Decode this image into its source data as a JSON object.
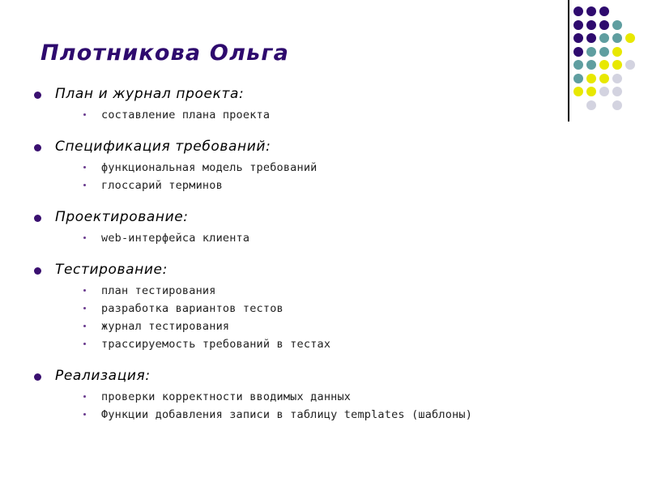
{
  "slide": {
    "title": "Плотникова Ольга",
    "background_color": "#ffffff",
    "title_color": "#2e0a6e",
    "bullet1_color": "#3a1070",
    "bullet2_color": "#6a3b8e",
    "text_color": "#000000"
  },
  "decor": {
    "name": "dot-grid-motif",
    "rule_color": "#000000",
    "palette": {
      "purple": "#2e0a6e",
      "teal": "#5f9ea0",
      "yellow": "#e8e800",
      "gray": "#d3d3e0"
    },
    "columns": 5,
    "rows": 8,
    "grid": [
      [
        "purple",
        "purple",
        "purple",
        "",
        ""
      ],
      [
        "purple",
        "purple",
        "purple",
        "teal",
        ""
      ],
      [
        "purple",
        "purple",
        "teal",
        "teal",
        "yellow"
      ],
      [
        "purple",
        "teal",
        "teal",
        "yellow",
        ""
      ],
      [
        "teal",
        "teal",
        "yellow",
        "yellow",
        "gray"
      ],
      [
        "teal",
        "yellow",
        "yellow",
        "gray",
        ""
      ],
      [
        "yellow",
        "yellow",
        "gray",
        "gray",
        ""
      ],
      [
        "",
        "gray",
        "",
        "gray",
        ""
      ]
    ]
  },
  "outline": [
    {
      "heading": "План и журнал проекта:",
      "items": [
        "составление плана проекта"
      ]
    },
    {
      "heading": "Спецификация требований:",
      "items": [
        "функциональная модель требований",
        "глоссарий терминов"
      ]
    },
    {
      "heading": "Проектирование:",
      "items": [
        "web-интерфейса клиента"
      ]
    },
    {
      "heading": "Тестирование:",
      "items": [
        "план тестирования",
        "разработка вариантов тестов",
        "журнал тестирования",
        "трассируемость требований в тестах"
      ]
    },
    {
      "heading": "Реализация:",
      "items": [
        "проверки корректности вводимых данных",
        "Функции добавления записи в таблицу templates (шаблоны)"
      ]
    }
  ]
}
